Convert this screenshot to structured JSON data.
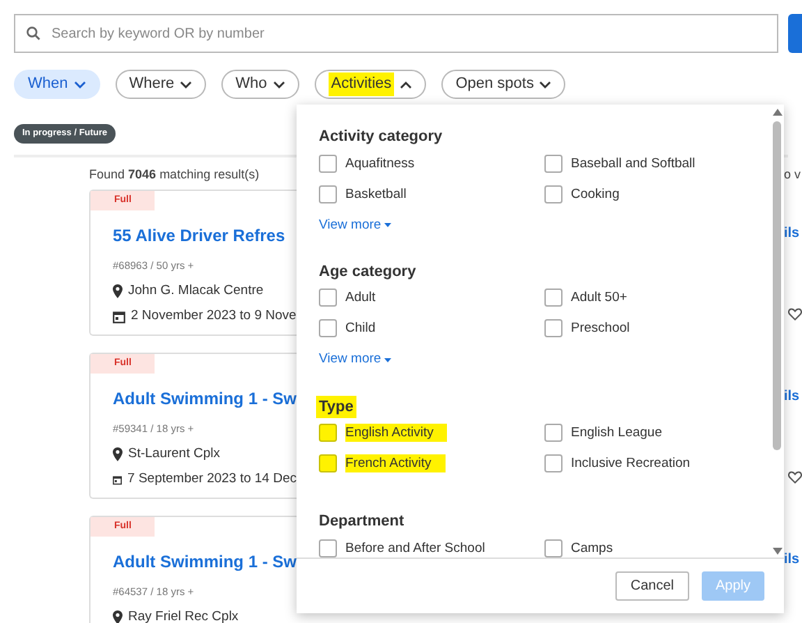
{
  "search": {
    "placeholder": "Search by keyword OR by number"
  },
  "filters": [
    {
      "label": "When",
      "selected": true,
      "expanded": false,
      "highlighted": false
    },
    {
      "label": "Where",
      "selected": false,
      "expanded": false,
      "highlighted": false
    },
    {
      "label": "Who",
      "selected": false,
      "expanded": false,
      "highlighted": false
    },
    {
      "label": "Activities",
      "selected": false,
      "expanded": true,
      "highlighted": true
    },
    {
      "label": "Open spots",
      "selected": false,
      "expanded": false,
      "highlighted": false
    }
  ],
  "status_badge": "In progress / Future",
  "results": {
    "summary": "Found **7046** matching result(s)",
    "right_fragment": "o v"
  },
  "cards": [
    {
      "badge": "Full",
      "title": "55 Alive Driver Refres",
      "meta": "#68963 / 50 yrs +",
      "location": "John G. Mlacak Centre",
      "dates": "2 November 2023 to 9 Nove",
      "right_link": "ils"
    },
    {
      "badge": "Full",
      "title": "Adult Swimming 1 - Sw",
      "meta": "#59341 / 18 yrs +",
      "location": "St-Laurent Cplx",
      "dates": "7 September 2023 to 14 Dec",
      "right_link": "ils"
    },
    {
      "badge": "Full",
      "title": "Adult Swimming 1 - Sw",
      "meta": "#64537 / 18 yrs +",
      "location": "Ray Friel Rec Cplx",
      "right_link": "ils"
    }
  ],
  "dropdown": {
    "sections": [
      {
        "title": "Activity category",
        "highlighted": false,
        "view_more": "View more",
        "options": [
          {
            "label": "Aquafitness",
            "checked": false,
            "highlighted": false
          },
          {
            "label": "Baseball and Softball",
            "checked": false,
            "highlighted": false
          },
          {
            "label": "Basketball",
            "checked": false,
            "highlighted": false
          },
          {
            "label": "Cooking",
            "checked": false,
            "highlighted": false
          }
        ]
      },
      {
        "title": "Age category",
        "highlighted": false,
        "view_more": "View more",
        "options": [
          {
            "label": "Adult",
            "checked": false,
            "highlighted": false
          },
          {
            "label": "Adult 50+",
            "checked": false,
            "highlighted": false
          },
          {
            "label": "Child",
            "checked": false,
            "highlighted": false
          },
          {
            "label": "Preschool",
            "checked": false,
            "highlighted": false
          }
        ]
      },
      {
        "title": "Type",
        "highlighted": true,
        "options": [
          {
            "label": "English Activity",
            "checked": false,
            "highlighted": true
          },
          {
            "label": "English League",
            "checked": false,
            "highlighted": false
          },
          {
            "label": "French Activity",
            "checked": false,
            "highlighted": true
          },
          {
            "label": "Inclusive Recreation",
            "checked": false,
            "highlighted": false
          }
        ]
      },
      {
        "title": "Department",
        "highlighted": false,
        "options": [
          {
            "label": "Before and After School",
            "checked": false,
            "highlighted": false
          },
          {
            "label": "Camps",
            "checked": false,
            "highlighted": false
          }
        ]
      }
    ],
    "buttons": [
      {
        "label": "Cancel",
        "disabled": false
      },
      {
        "label": "Apply",
        "disabled": true
      }
    ]
  }
}
